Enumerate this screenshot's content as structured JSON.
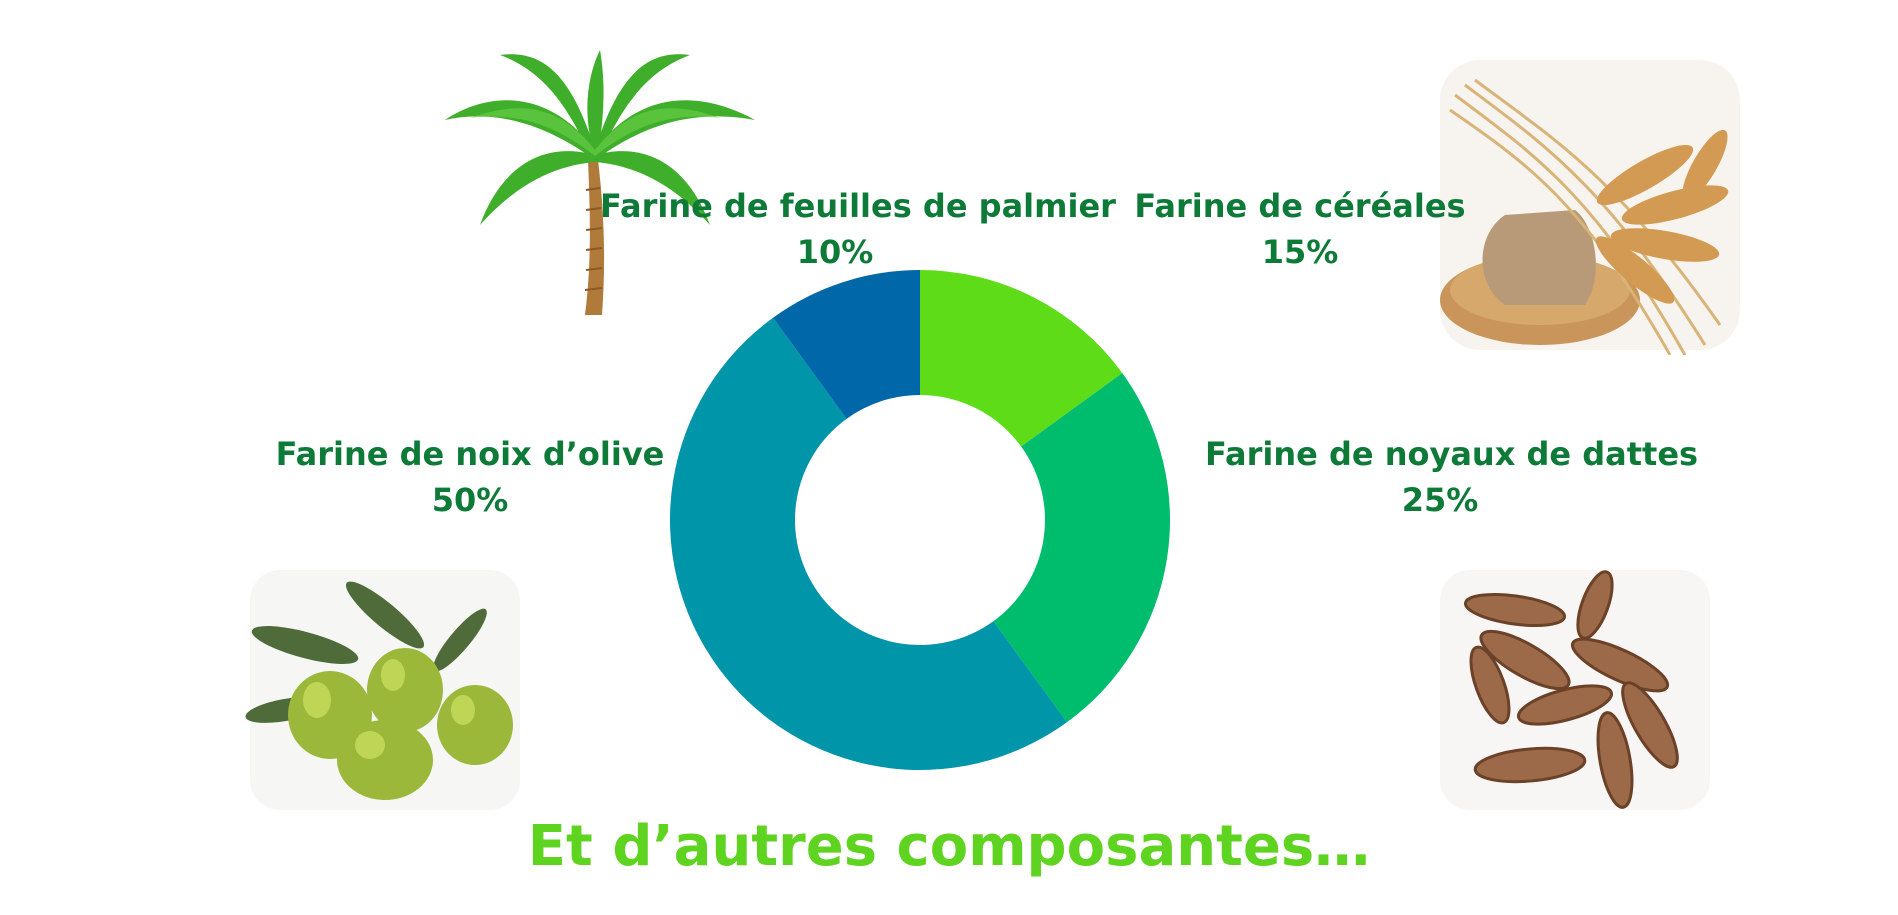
{
  "chart_data": {
    "type": "pie",
    "donut": true,
    "categories": [
      "Farine de céréales",
      "Farine de noyaux de dattes",
      "Farine de noix d’olive",
      "Farine de feuilles de palmier"
    ],
    "values": [
      15,
      25,
      50,
      10
    ],
    "value_labels": [
      "15%",
      "25%",
      "50%",
      "10%"
    ],
    "colors": [
      "#5edc18",
      "#00bd6e",
      "#0095a8",
      "#0068a8"
    ],
    "start_angle_deg": 0,
    "direction": "clockwise"
  },
  "labels": {
    "palm": {
      "name": "Farine de feuilles de palmier",
      "value": "10%"
    },
    "cereal": {
      "name": "Farine de céréales",
      "value": "15%"
    },
    "olive": {
      "name": "Farine de noix d’olive",
      "value": "50%"
    },
    "dates": {
      "name": "Farine de noyaux de dattes",
      "value": "25%"
    }
  },
  "footer": "Et d’autres composantes…",
  "images": {
    "palm": "palm-tree",
    "cereal": "wheat-bundle",
    "olive": "green-olives",
    "dates": "date-pits"
  },
  "colors": {
    "label_text": "#0e7a38",
    "footer_text": "#5fd420"
  }
}
